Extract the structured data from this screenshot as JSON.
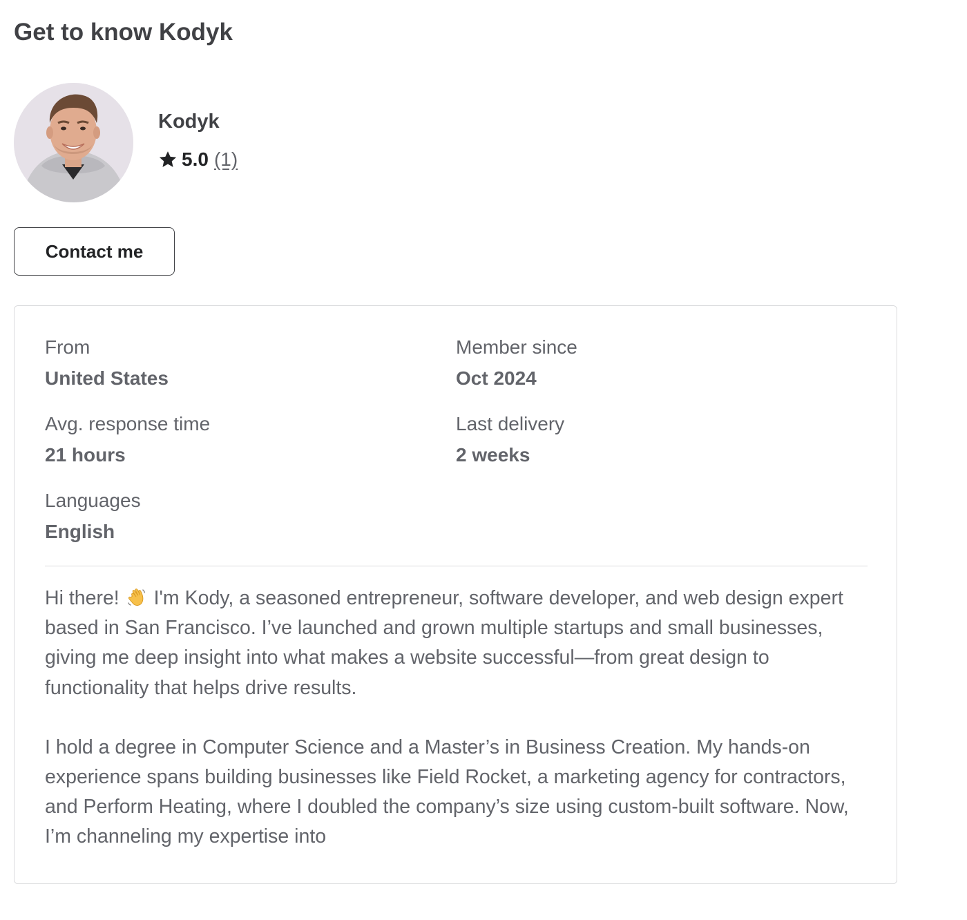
{
  "section_title": "Get to know Kodyk",
  "seller": {
    "name": "Kodyk",
    "avatar_icon": "profile-photo",
    "rating": {
      "star_icon": "star-icon",
      "score": "5.0",
      "count": "(1)"
    }
  },
  "contact_button_label": "Contact me",
  "stats": {
    "from": {
      "label": "From",
      "value": "United States"
    },
    "member_since": {
      "label": "Member since",
      "value": "Oct 2024"
    },
    "avg_response": {
      "label": "Avg. response time",
      "value": "21 hours"
    },
    "last_delivery": {
      "label": "Last delivery",
      "value": "2 weeks"
    },
    "languages": {
      "label": "Languages",
      "value": "English"
    }
  },
  "bio": {
    "p1_before_emoji": "Hi there!",
    "emoji_icon": "waving-hand-icon",
    "p1_after_emoji": "I'm Kody, a seasoned entrepreneur, software developer, and web design expert based in San Francisco. I’ve launched and grown multiple startups and small businesses, giving me deep insight into what makes a website successful—from great design to functionality that helps drive results.",
    "p2": "I hold a degree in Computer Science and a Master’s in Business Creation. My hands-on experience spans building businesses like Field Rocket, a marketing agency for contractors, and Perform Heating, where I doubled the company’s size using custom-built software. Now, I’m channeling my expertise into"
  }
}
